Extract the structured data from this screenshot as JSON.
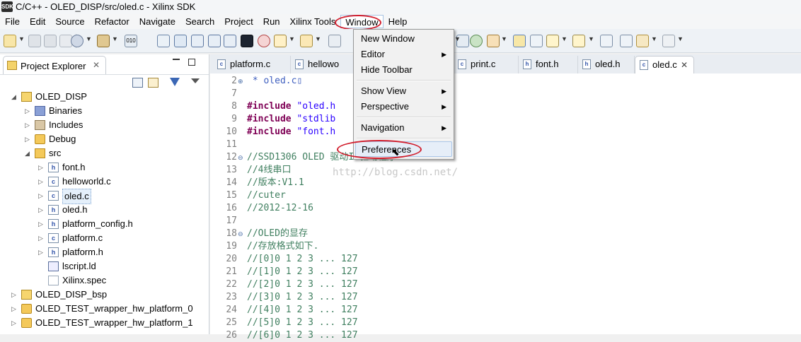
{
  "window": {
    "app_icon_label": "SDK",
    "title": "C/C++ - OLED_DISP/src/oled.c - Xilinx SDK"
  },
  "menubar": {
    "items": [
      "File",
      "Edit",
      "Source",
      "Refactor",
      "Navigate",
      "Search",
      "Project",
      "Run",
      "Xilinx Tools",
      "Window",
      "Help"
    ]
  },
  "explorer": {
    "tab_label": "Project Explorer",
    "tree": [
      {
        "label": "OLED_DISP",
        "indent": 0,
        "expanded": true,
        "icon": "project-icon"
      },
      {
        "label": "Binaries",
        "indent": 1,
        "expanded": false,
        "icon": "binaries-icon"
      },
      {
        "label": "Includes",
        "indent": 1,
        "expanded": false,
        "icon": "includes-icon"
      },
      {
        "label": "Debug",
        "indent": 1,
        "expanded": false,
        "icon": "folder-icon"
      },
      {
        "label": "src",
        "indent": 1,
        "expanded": true,
        "icon": "source-folder-icon"
      },
      {
        "label": "font.h",
        "indent": 2,
        "expanded": false,
        "icon": "header-file-icon"
      },
      {
        "label": "helloworld.c",
        "indent": 2,
        "expanded": false,
        "icon": "c-file-icon"
      },
      {
        "label": "oled.c",
        "indent": 2,
        "expanded": false,
        "icon": "c-file-icon",
        "selected": true
      },
      {
        "label": "oled.h",
        "indent": 2,
        "expanded": false,
        "icon": "header-file-icon"
      },
      {
        "label": "platform_config.h",
        "indent": 2,
        "expanded": false,
        "icon": "header-file-icon"
      },
      {
        "label": "platform.c",
        "indent": 2,
        "expanded": false,
        "icon": "c-file-icon"
      },
      {
        "label": "platform.h",
        "indent": 2,
        "expanded": false,
        "icon": "header-file-icon"
      },
      {
        "label": "lscript.ld",
        "indent": 2,
        "expanded": null,
        "icon": "linker-script-icon"
      },
      {
        "label": "Xilinx.spec",
        "indent": 2,
        "expanded": null,
        "icon": "spec-file-icon"
      },
      {
        "label": "OLED_DISP_bsp",
        "indent": 0,
        "expanded": false,
        "icon": "bsp-project-icon"
      },
      {
        "label": "OLED_TEST_wrapper_hw_platform_0",
        "indent": 0,
        "expanded": false,
        "icon": "hw-platform-icon"
      },
      {
        "label": "OLED_TEST_wrapper_hw_platform_1",
        "indent": 0,
        "expanded": false,
        "icon": "hw-platform-icon"
      }
    ]
  },
  "editor": {
    "tabs": [
      {
        "label": "platform.c",
        "icon_text": "c"
      },
      {
        "label": "hellowo",
        "icon_text": "c"
      },
      {
        "label": "print.c",
        "icon_text": "c"
      },
      {
        "label": "font.h",
        "icon_text": "h"
      },
      {
        "label": "oled.h",
        "icon_text": "h"
      },
      {
        "label": "oled.c",
        "icon_text": "c",
        "active": true
      }
    ],
    "lines": [
      {
        "num": "2",
        "fold": "+",
        "text": " * oled.c▯",
        "kind": "plain"
      },
      {
        "num": "7",
        "fold": "",
        "text": "",
        "kind": "plain"
      },
      {
        "num": "8",
        "fold": "",
        "pre": "#include ",
        "text": "\"oled.h",
        "kind": "include"
      },
      {
        "num": "9",
        "fold": "",
        "pre": "#include ",
        "text": "\"stdlib",
        "kind": "include"
      },
      {
        "num": "10",
        "fold": "",
        "pre": "#include ",
        "text": "\"font.h",
        "kind": "include"
      },
      {
        "num": "11",
        "fold": "",
        "text": "",
        "kind": "plain"
      },
      {
        "num": "12",
        "fold": "-",
        "text": "//SSD1306 OLED 驱动IC驱动程序",
        "kind": "comment"
      },
      {
        "num": "13",
        "fold": "",
        "text": "//4线串口",
        "kind": "comment"
      },
      {
        "num": "14",
        "fold": "",
        "text": "//版本:V1.1",
        "kind": "comment"
      },
      {
        "num": "15",
        "fold": "",
        "text": "//cuter",
        "kind": "comment"
      },
      {
        "num": "16",
        "fold": "",
        "text": "//2012-12-16",
        "kind": "comment"
      },
      {
        "num": "17",
        "fold": "",
        "text": "",
        "kind": "plain"
      },
      {
        "num": "18",
        "fold": "-",
        "text": "//OLED的显存",
        "kind": "comment"
      },
      {
        "num": "19",
        "fold": "",
        "text": "//存放格式如下.",
        "kind": "comment"
      },
      {
        "num": "20",
        "fold": "",
        "text": "//[0]0 1 2 3 ... 127",
        "kind": "comment"
      },
      {
        "num": "21",
        "fold": "",
        "text": "//[1]0 1 2 3 ... 127",
        "kind": "comment"
      },
      {
        "num": "22",
        "fold": "",
        "text": "//[2]0 1 2 3 ... 127",
        "kind": "comment"
      },
      {
        "num": "23",
        "fold": "",
        "text": "//[3]0 1 2 3 ... 127",
        "kind": "comment"
      },
      {
        "num": "24",
        "fold": "",
        "text": "//[4]0 1 2 3 ... 127",
        "kind": "comment"
      },
      {
        "num": "25",
        "fold": "",
        "text": "//[5]0 1 2 3 ... 127",
        "kind": "comment"
      },
      {
        "num": "26",
        "fold": "",
        "text": "//[6]0 1 2 3 ... 127",
        "kind": "comment"
      }
    ],
    "watermark": "http://blog.csdn.net/"
  },
  "window_menu": {
    "items": [
      {
        "label": "New Window",
        "submenu": false
      },
      {
        "label": "Editor",
        "submenu": true
      },
      {
        "label": "Hide Toolbar",
        "submenu": false
      },
      {
        "sep": true
      },
      {
        "label": "Show View",
        "submenu": true
      },
      {
        "label": "Perspective",
        "submenu": true
      },
      {
        "sep": true
      },
      {
        "label": "Navigation",
        "submenu": true
      },
      {
        "sep": true
      },
      {
        "label": "Preferences",
        "submenu": false,
        "hover": true
      }
    ]
  },
  "colors": {
    "annotation_circle": "#d21f2e",
    "comment": "#3f7f5f",
    "directive": "#7f0055",
    "string": "#2a00ff"
  }
}
